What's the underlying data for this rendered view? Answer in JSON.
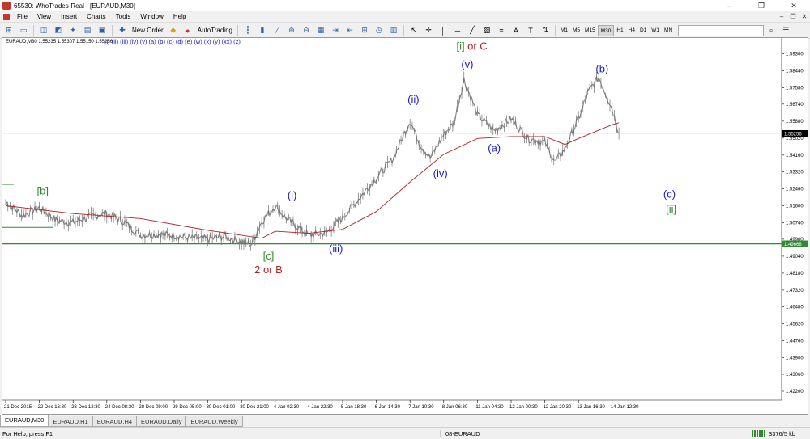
{
  "window": {
    "title": "65530: WhoTrades-Real - [EURAUD,M30]",
    "minimize": "–",
    "maximize": "❐",
    "close": "✕"
  },
  "menu": {
    "items": [
      "File",
      "View",
      "Insert",
      "Charts",
      "Tools",
      "Window",
      "Help"
    ],
    "mdi": [
      "–",
      "❐",
      "✕"
    ]
  },
  "toolbar": {
    "new_order_label": "New Order",
    "autotrading_label": "AutoTrading",
    "timeframes": [
      "M1",
      "M5",
      "M15",
      "M30",
      "H1",
      "H4",
      "D1",
      "W1",
      "MN"
    ],
    "active_timeframe": "M30",
    "search_icon": "magnifier-icon"
  },
  "chart": {
    "symbol_header": "EURAUD,M30  1.55235 1.55307 1.55150 1.55256",
    "wave_legend": "(i) (ii) (iii) (iv) (v) (a) (b) (c) (d) (e) (w) (x) (y) (xx) (z)",
    "current_price_label": "1.55256",
    "hline_price_label": "1.49668"
  },
  "chart_data": {
    "type": "line",
    "title": "",
    "symbol": "EURAUD",
    "timeframe": "M30",
    "ylim": [
      1.4175,
      1.6009
    ],
    "y_ticks": [
      1.593,
      1.5844,
      1.5758,
      1.5674,
      1.5588,
      1.5502,
      1.5416,
      1.5332,
      1.5246,
      1.516,
      1.5074,
      1.499,
      1.4904,
      1.4818,
      1.4732,
      1.4648,
      1.4562,
      1.4476,
      1.439,
      1.4306,
      1.422
    ],
    "x_tick_labels": [
      "21 Dec 2015",
      "22 Dec 16:30",
      "23 Dec 12:30",
      "24 Dec 08:30",
      "28 Dec 09:00",
      "29 Dec 05:00",
      "30 Dec 01:00",
      "30 Dec 21:00",
      "4 Jan 02:30",
      "4 Jan 22:30",
      "5 Jan 18:30",
      "6 Jan 14:30",
      "7 Jan 10:30",
      "8 Jan 06:30",
      "11 Jan 04:30",
      "12 Jan 00:30",
      "12 Jan 20:30",
      "13 Jan 16:30",
      "14 Jan 12:30"
    ],
    "grid": false,
    "price_series": {
      "name": "",
      "color": "#808080",
      "x_index": [
        0,
        0.5,
        1,
        1.5,
        2,
        2.5,
        3,
        3.5,
        4,
        4.5,
        5,
        5.5,
        6,
        6.5,
        7,
        7.3,
        7.6,
        8,
        8.3,
        8.6,
        9,
        9.5,
        10,
        10.5,
        11,
        11.5,
        12,
        12.3,
        12.6,
        13,
        13.3,
        13.6,
        14,
        14.5,
        15,
        15.5,
        16,
        16.3,
        16.6,
        17,
        17.3,
        17.6,
        18,
        18.2
      ],
      "values": [
        1.518,
        1.511,
        1.515,
        1.5085,
        1.5075,
        1.5105,
        1.512,
        1.508,
        1.501,
        1.5015,
        1.501,
        1.4995,
        1.499,
        1.5005,
        1.4975,
        1.4965,
        1.508,
        1.516,
        1.51,
        1.506,
        1.501,
        1.502,
        1.51,
        1.52,
        1.53,
        1.54,
        1.559,
        1.547,
        1.54,
        1.552,
        1.558,
        1.58,
        1.562,
        1.554,
        1.56,
        1.55,
        1.548,
        1.538,
        1.545,
        1.56,
        1.574,
        1.581,
        1.565,
        1.5526
      ]
    },
    "moving_average": {
      "name": "",
      "color": "#b22222",
      "x_index": [
        0,
        2,
        4,
        6,
        7.6,
        8,
        9,
        10,
        11,
        12,
        13,
        14,
        15,
        16,
        16.6,
        17,
        18,
        18.2
      ],
      "values": [
        1.516,
        1.512,
        1.5095,
        1.5035,
        1.4995,
        1.503,
        1.502,
        1.504,
        1.513,
        1.528,
        1.542,
        1.55,
        1.551,
        1.551,
        1.547,
        1.55,
        1.557,
        1.558
      ]
    },
    "horizontal_line": {
      "value": 1.4967,
      "color": "#2e8b2e"
    },
    "annotations": [
      {
        "text": "[b]",
        "x_index": 1.1,
        "value": 1.5216,
        "color": "#2e8b2e"
      },
      {
        "text": "[c]",
        "x_index": 7.8,
        "value": 1.4888,
        "color": "#2e8b2e"
      },
      {
        "text": "2 or B",
        "x_index": 7.8,
        "value": 1.4818,
        "color": "#b22222"
      },
      {
        "text": "(i)",
        "x_index": 8.5,
        "value": 1.5195,
        "color": "#1a1acd"
      },
      {
        "text": "(iii)",
        "x_index": 9.8,
        "value": 1.4925,
        "color": "#1a1acd"
      },
      {
        "text": "(ii)",
        "x_index": 12.1,
        "value": 1.568,
        "color": "#1a1acd"
      },
      {
        "text": "(iv)",
        "x_index": 12.9,
        "value": 1.5305,
        "color": "#1a1acd"
      },
      {
        "text": "[i]",
        "x_index": 13.5,
        "value": 1.595,
        "color": "#2e8b2e"
      },
      {
        "text": "or C",
        "x_index": 14.0,
        "value": 1.595,
        "color": "#b22222"
      },
      {
        "text": "(v)",
        "x_index": 13.7,
        "value": 1.5858,
        "color": "#1a1acd"
      },
      {
        "text": "(a)",
        "x_index": 14.5,
        "value": 1.5433,
        "color": "#1a1acd"
      },
      {
        "text": "(b)",
        "x_index": 17.7,
        "value": 1.5835,
        "color": "#1a1acd"
      },
      {
        "text": "(c)",
        "x_index": 19.7,
        "value": 1.52,
        "color": "#1a1acd"
      },
      {
        "text": "[ii]",
        "x_index": 19.75,
        "value": 1.5125,
        "color": "#2e8b2e"
      }
    ],
    "left_markers": [
      {
        "value": 1.5268,
        "color": "#2e8b2e"
      },
      {
        "value": 1.505,
        "color": "#2e8b2e"
      }
    ]
  },
  "tabs": [
    "EURAUD,M30",
    "EURAUD,H1",
    "EURAUD,H4",
    "EURAUD,Daily",
    "EURAUD,Weekly"
  ],
  "active_tab": "EURAUD,M30",
  "status": {
    "help": "For Help, press F1",
    "profile": "08-EURAUD",
    "traffic": "3376/5 kb"
  }
}
